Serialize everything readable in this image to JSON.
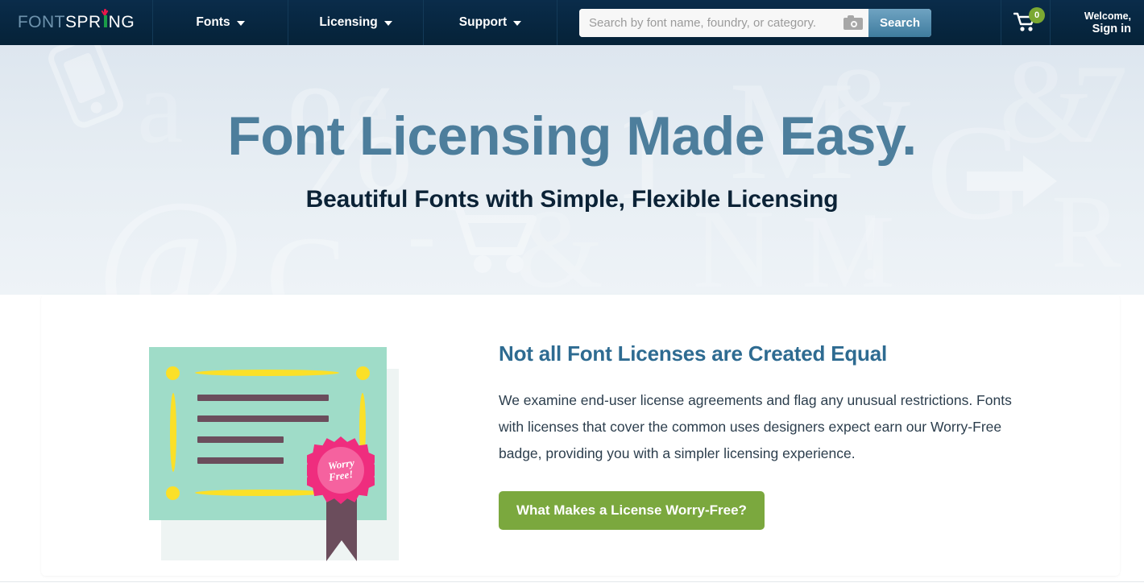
{
  "header": {
    "logo": {
      "part1": "FONT",
      "part2": "SPR",
      "part3": "NG",
      "sprout_icon": "sprout-icon"
    },
    "nav": [
      {
        "label": "Fonts",
        "icon": "chevron-down-icon"
      },
      {
        "label": "Licensing",
        "icon": "chevron-down-icon"
      },
      {
        "label": "Support",
        "icon": "chevron-down-icon"
      }
    ],
    "search": {
      "placeholder": "Search by font name, foundry, or category.",
      "value": "",
      "camera_icon": "camera-icon",
      "button_label": "Search"
    },
    "cart": {
      "icon": "shopping-cart-icon",
      "count": "0",
      "badge_color": "#7ba832"
    },
    "account": {
      "line1": "Welcome,",
      "line2": "Sign in"
    },
    "background_color": "#052238"
  },
  "hero": {
    "title": "Font Licensing Made Easy.",
    "subtitle": "Beautiful Fonts with Simple, Flexible Licensing",
    "title_color": "#4d7e9c",
    "subtitle_color": "#0b2236",
    "background_color": "#e6edf3"
  },
  "card": {
    "illustration": {
      "name": "certificate-illustration",
      "certificate_color": "#9fdcc8",
      "accent_color": "#fbe028",
      "line_color": "#6b4d5c",
      "badge": {
        "color": "#ef2d7e",
        "inner_color": "#f5629f",
        "line1": "Worry",
        "line2": "Free!"
      }
    },
    "heading": "Not all Font Licenses are Created Equal",
    "body": "We examine end-user license agreements and flag any unusual restrictions. Fonts with licenses that cover the common uses designers expect earn our Worry-Free badge, providing you with a simpler licensing experience.",
    "cta_label": "What Makes a License Worry-Free?",
    "cta_color": "#7ba83e",
    "heading_color": "#2e6b91"
  }
}
